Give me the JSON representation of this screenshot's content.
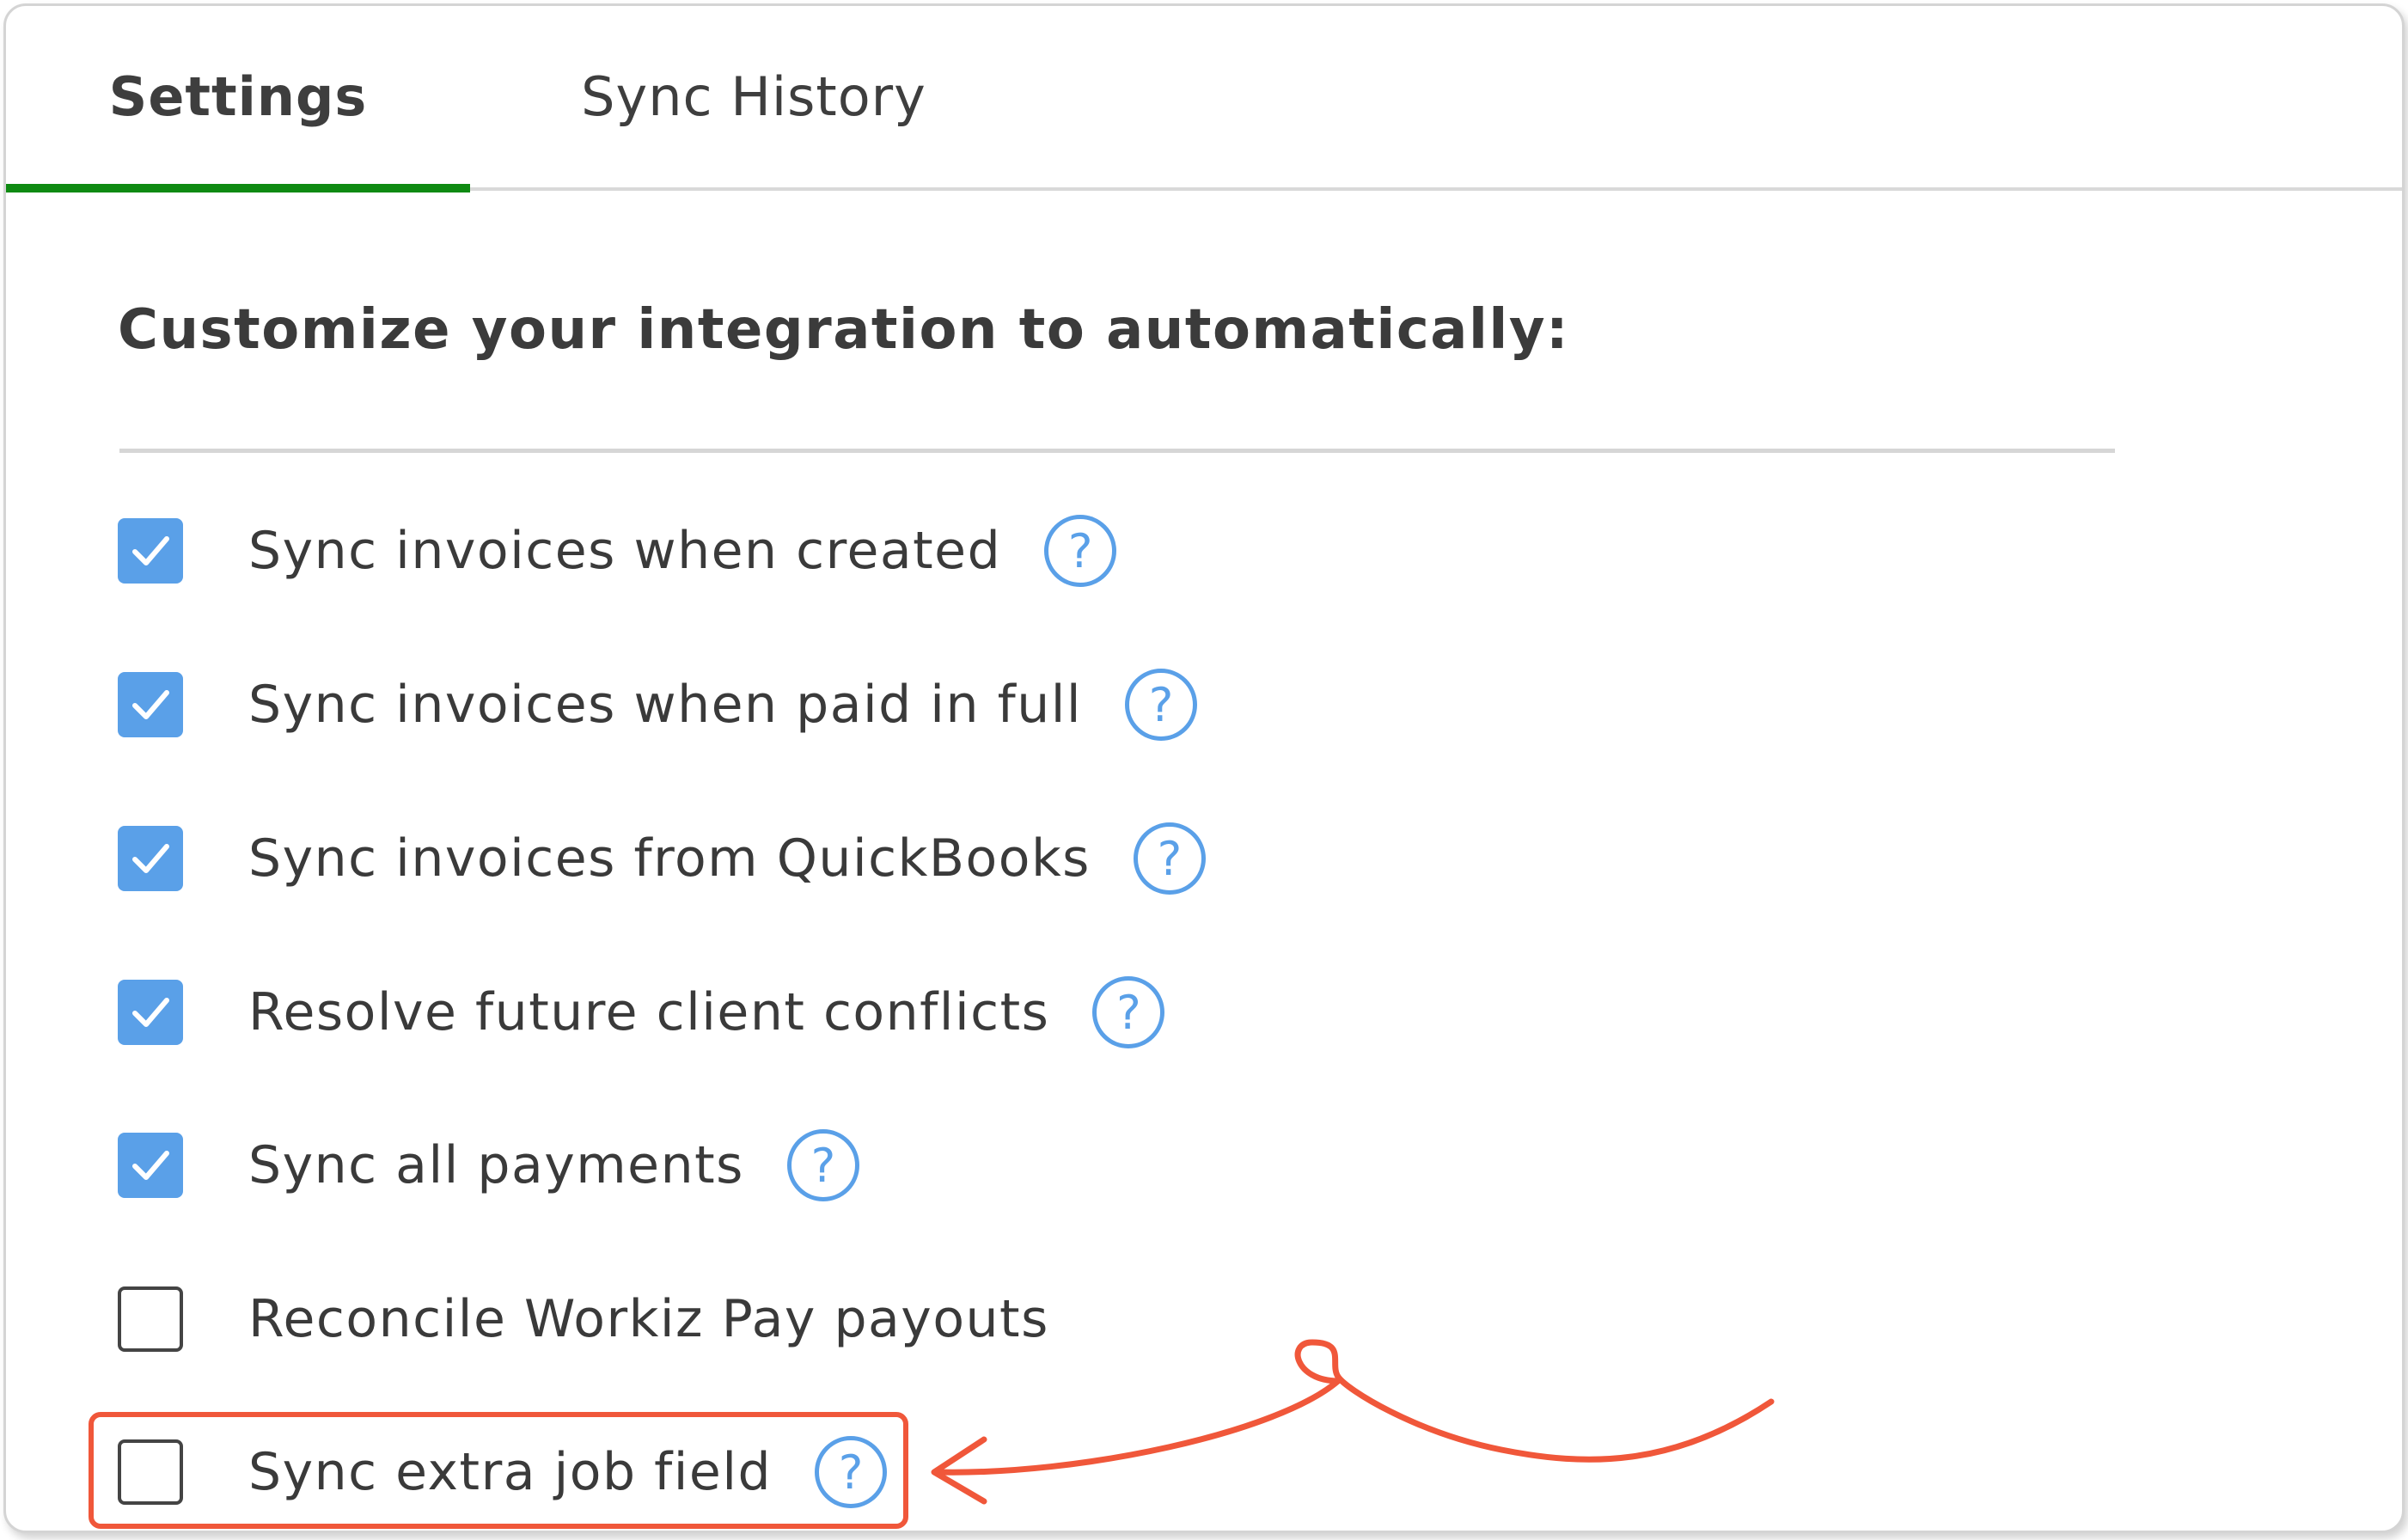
{
  "tabs": [
    {
      "label": "Settings",
      "active": true
    },
    {
      "label": "Sync History",
      "active": false
    }
  ],
  "heading": "Customize your integration to automatically:",
  "options": [
    {
      "label": "Sync invoices when created",
      "checked": true,
      "help": "?"
    },
    {
      "label": "Sync invoices when paid in full",
      "checked": true,
      "help": "?"
    },
    {
      "label": "Sync invoices from QuickBooks",
      "checked": true,
      "help": "?"
    },
    {
      "label": "Resolve future client conflicts",
      "checked": true,
      "help": "?"
    },
    {
      "label": "Sync all payments",
      "checked": true,
      "help": "?"
    },
    {
      "label": "Reconcile Workiz Pay payouts",
      "checked": false
    },
    {
      "label": "Sync extra job field",
      "checked": false,
      "help": "?",
      "highlighted": true
    }
  ],
  "colors": {
    "accent": "#5aa0e8",
    "tab_underline": "#0f8a12",
    "annotation": "#f0573a"
  },
  "icons": {
    "check": "check-icon",
    "help": "help-question-icon",
    "annotation": "arrow-annotation-icon"
  }
}
